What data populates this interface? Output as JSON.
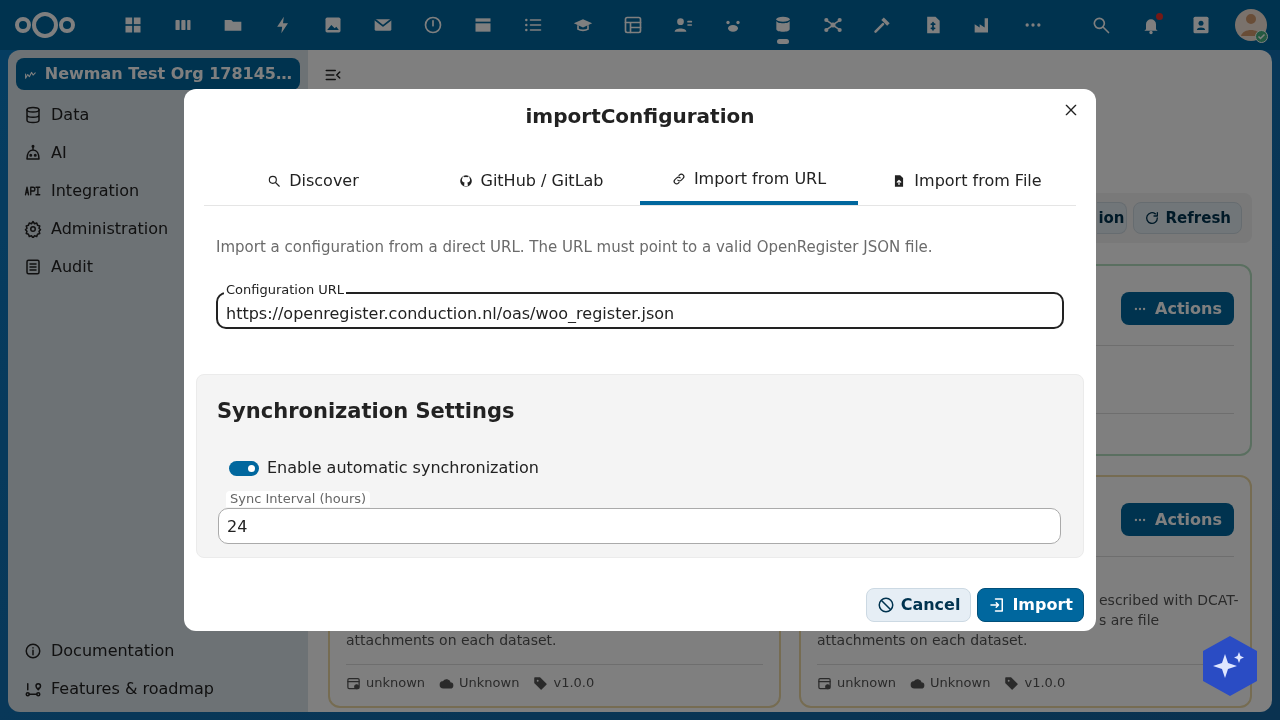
{
  "sidebar": {
    "organization": "Newman Test Org 178145…",
    "items": [
      {
        "label": "Data"
      },
      {
        "label": "AI"
      },
      {
        "label": "Integration"
      },
      {
        "label": "Administration"
      },
      {
        "label": "Audit"
      }
    ],
    "footer_items": [
      {
        "label": "Documentation"
      },
      {
        "label": "Features & roadmap"
      }
    ]
  },
  "toolbar": {
    "buttons": [
      "ion",
      "Refresh"
    ]
  },
  "columns": [
    {
      "cards": [
        {
          "lines": [
            "attachments on each dataset."
          ],
          "meta": [
            "unknown",
            "Unknown",
            "v1.0.0"
          ]
        }
      ]
    },
    {
      "cards": [
        {
          "actions": "Actions"
        },
        {
          "actions": "Actions",
          "lines": [
            "escribed with DCAT-",
            "s are file",
            "attachments on each dataset."
          ],
          "meta": [
            "unknown",
            "Unknown",
            "v1.0.0"
          ]
        }
      ]
    }
  ],
  "dialog": {
    "title": "importConfiguration",
    "tabs": [
      {
        "label": "Discover",
        "selected": false
      },
      {
        "label": "GitHub / GitLab",
        "selected": false
      },
      {
        "label": "Import from URL",
        "selected": true
      },
      {
        "label": "Import from File",
        "selected": false
      }
    ],
    "description": "Import a configuration from a direct URL. The URL must point to a valid OpenRegister JSON file.",
    "url_field": {
      "label": "Configuration URL",
      "value": "https://openregister.conduction.nl/oas/woo_register.json"
    },
    "sync": {
      "heading": "Synchronization Settings",
      "toggle": {
        "label": "Enable automatic synchronization",
        "on": true
      },
      "interval_field": {
        "label": "Sync Interval (hours)",
        "value": "24"
      }
    },
    "buttons": [
      {
        "label": "Cancel",
        "kind": "secondary"
      },
      {
        "label": "Import",
        "kind": "primary"
      }
    ]
  }
}
